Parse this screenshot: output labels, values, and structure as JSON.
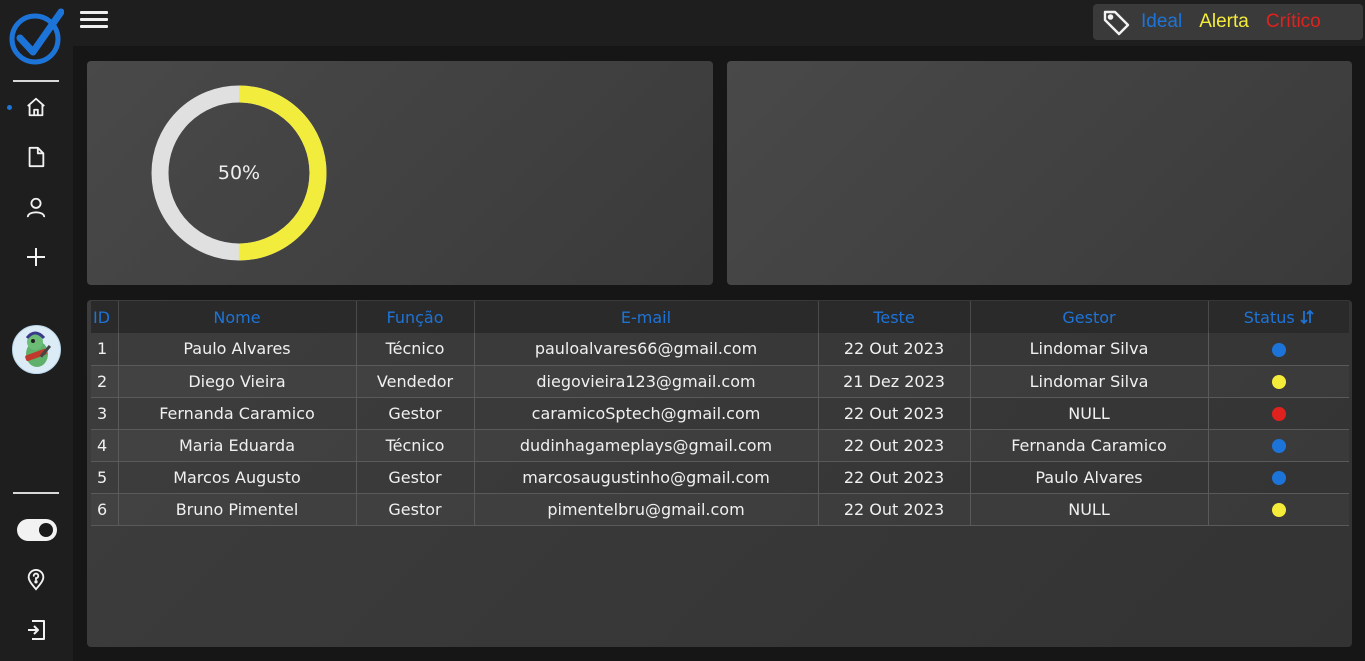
{
  "legend": {
    "ideal": "Ideal",
    "alerta": "Alerta",
    "critico": "Crítico",
    "colors": {
      "ideal": "#1d74d8",
      "alerta": "#f5ec3a",
      "critico": "#e0221e"
    }
  },
  "gauge": {
    "label": "50%",
    "value": 0.5,
    "color": "#f2ec3c",
    "track_color": "#e0e0e0"
  },
  "table": {
    "headers": {
      "id": "ID",
      "nome": "Nome",
      "funcao": "Função",
      "email": "E-mail",
      "teste": "Teste",
      "gestor": "Gestor",
      "status": "Status"
    },
    "rows": [
      {
        "id": "1",
        "nome": "Paulo Alvares",
        "funcao": "Técnico",
        "email": "pauloalvares66@gmail.com",
        "teste": "22 Out 2023",
        "gestor": "Lindomar Silva",
        "status_color": "#1d74d8"
      },
      {
        "id": "2",
        "nome": "Diego Vieira",
        "funcao": "Vendedor",
        "email": "diegovieira123@gmail.com",
        "teste": "21 Dez 2023",
        "gestor": "Lindomar Silva",
        "status_color": "#f5ec3a"
      },
      {
        "id": "3",
        "nome": "Fernanda Caramico",
        "funcao": "Gestor",
        "email": "caramicoSptech@gmail.com",
        "teste": "22 Out 2023",
        "gestor": "NULL",
        "status_color": "#e0221e"
      },
      {
        "id": "4",
        "nome": "Maria Eduarda",
        "funcao": "Técnico",
        "email": "dudinhagameplays@gmail.com",
        "teste": "22 Out 2023",
        "gestor": "Fernanda Caramico",
        "status_color": "#1d74d8"
      },
      {
        "id": "5",
        "nome": "Marcos Augusto",
        "funcao": "Gestor",
        "email": "marcosaugustinho@gmail.com",
        "teste": "22 Out 2023",
        "gestor": "Paulo Alvares",
        "status_color": "#1d74d8"
      },
      {
        "id": "6",
        "nome": "Bruno Pimentel",
        "funcao": "Gestor",
        "email": "pimentelbru@gmail.com",
        "teste": "22 Out 2023",
        "gestor": "NULL",
        "status_color": "#f5ec3a"
      }
    ]
  },
  "icons": {
    "logo": "checkmark-logo-icon",
    "nav": [
      "home-icon",
      "document-icon",
      "user-icon",
      "plus-icon"
    ],
    "bottom": [
      "toggle-switch",
      "help-location-icon",
      "logout-icon"
    ],
    "legend": "tag-icon",
    "sort": "sort-icon"
  }
}
